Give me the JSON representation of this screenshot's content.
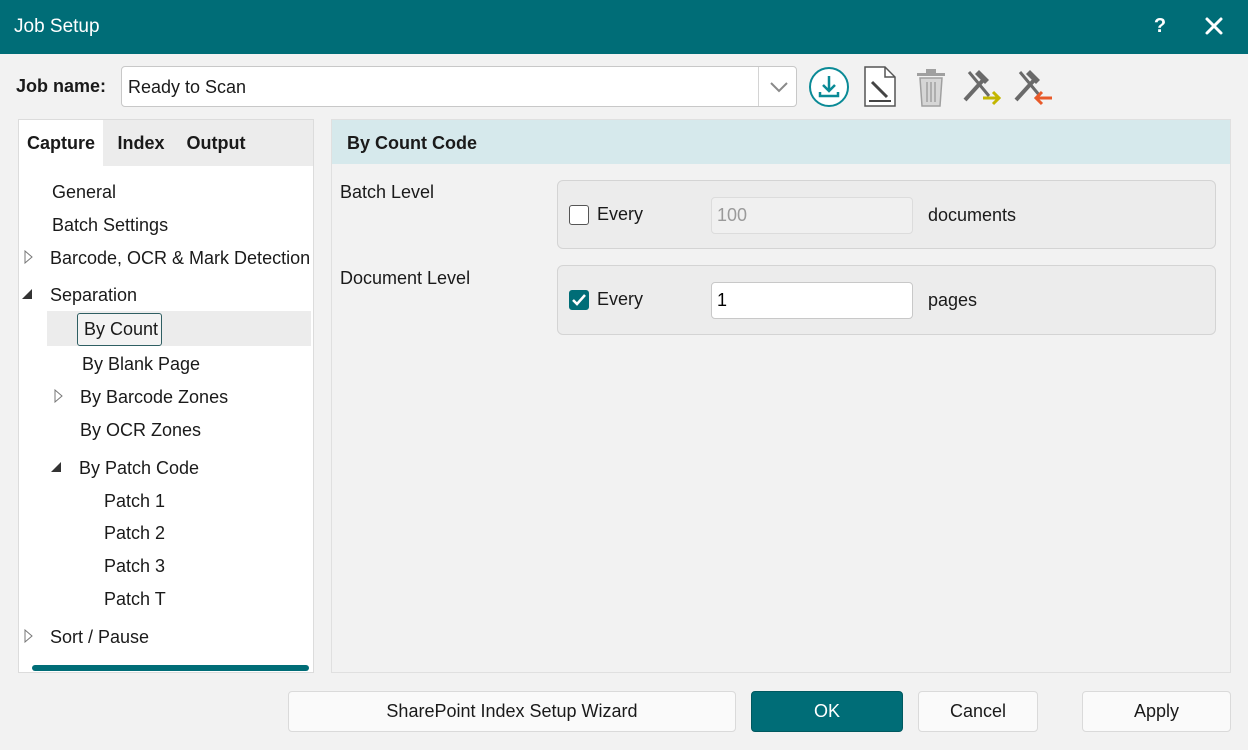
{
  "window": {
    "title": "Job Setup",
    "help_label": "?"
  },
  "job": {
    "label": "Job name:",
    "value": "Ready to Scan"
  },
  "toolbar_icons": [
    "download-icon",
    "edit-document-icon",
    "trash-icon",
    "tools-import-icon",
    "tools-export-icon"
  ],
  "tabs": [
    {
      "label": "Capture",
      "active": true
    },
    {
      "label": "Index",
      "active": false
    },
    {
      "label": "Output",
      "active": false
    }
  ],
  "tree": {
    "general": "General",
    "batch_settings": "Batch Settings",
    "barcode_ocr": "Barcode, OCR & Mark Detection",
    "separation": "Separation",
    "by_count": "By Count",
    "by_blank_page": "By Blank Page",
    "by_barcode_zones": "By Barcode Zones",
    "by_ocr_zones": "By OCR Zones",
    "by_patch_code": "By Patch Code",
    "patch_1": "Patch 1",
    "patch_2": "Patch 2",
    "patch_3": "Patch 3",
    "patch_t": "Patch T",
    "sort_pause": "Sort / Pause"
  },
  "section": {
    "title": "By Count Code",
    "batch_level": {
      "label": "Batch Level",
      "checkbox_label": "Every",
      "checked": false,
      "value": "100",
      "unit": "documents"
    },
    "document_level": {
      "label": "Document Level",
      "checkbox_label": "Every",
      "checked": true,
      "value": "1",
      "unit": "pages"
    }
  },
  "buttons": {
    "wizard": "SharePoint Index Setup Wizard",
    "ok": "OK",
    "cancel": "Cancel",
    "apply": "Apply"
  },
  "colors": {
    "accent": "#006d77",
    "section_header": "#d6e9ec"
  }
}
